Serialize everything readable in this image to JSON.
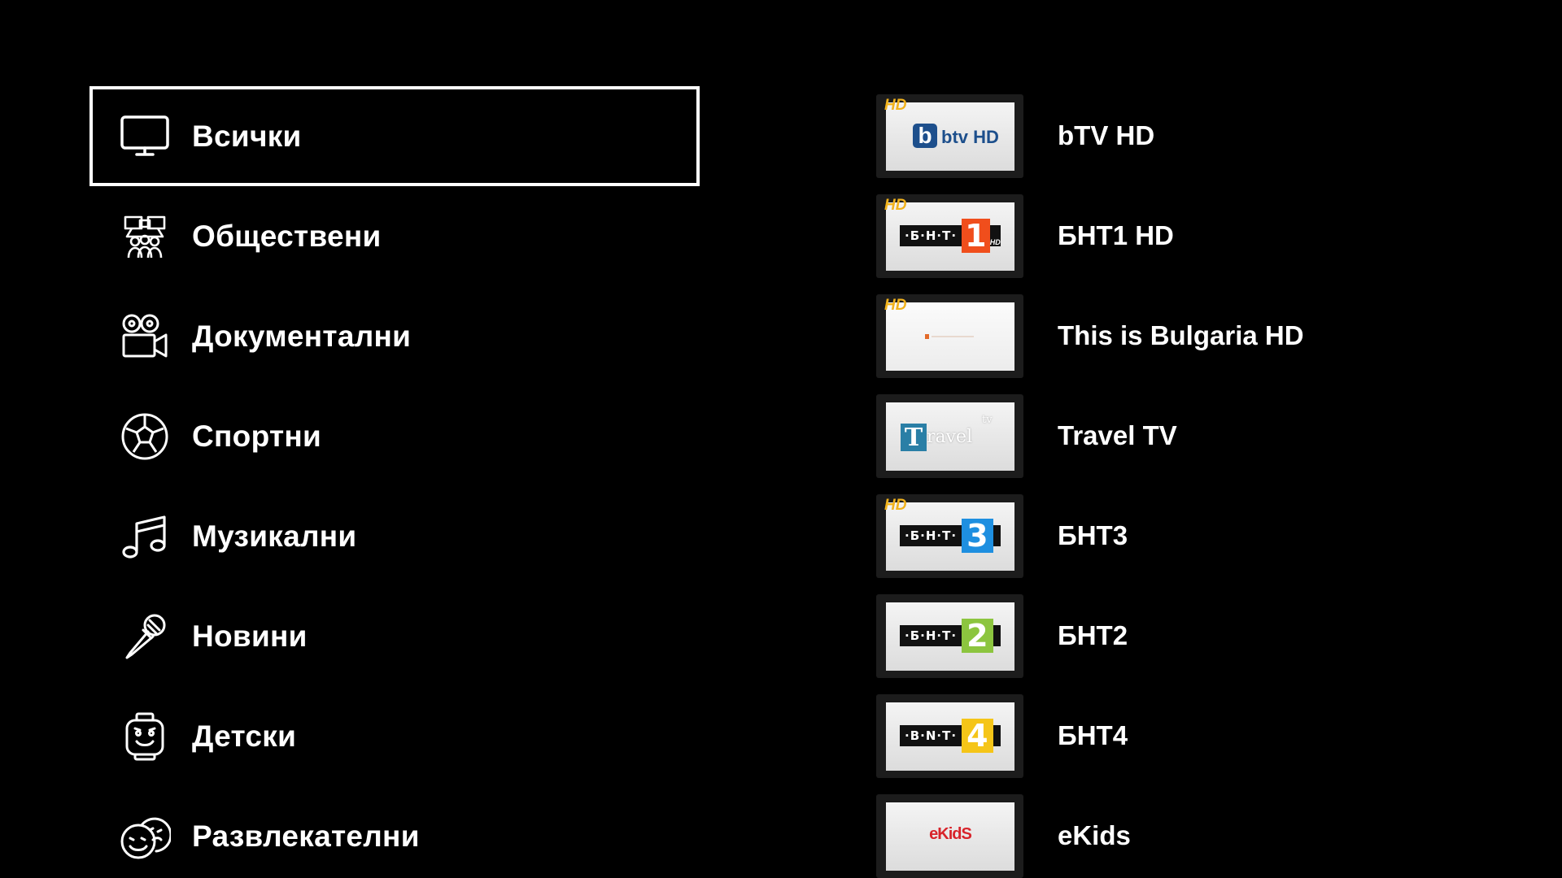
{
  "categories": [
    {
      "label": "Всички",
      "icon": "tv-icon",
      "selected": true
    },
    {
      "label": "Обществени",
      "icon": "community-icon",
      "selected": false
    },
    {
      "label": "Документални",
      "icon": "film-camera-icon",
      "selected": false
    },
    {
      "label": "Спортни",
      "icon": "soccer-ball-icon",
      "selected": false
    },
    {
      "label": "Музикални",
      "icon": "music-note-icon",
      "selected": false
    },
    {
      "label": "Новини",
      "icon": "microphone-icon",
      "selected": false
    },
    {
      "label": "Детски",
      "icon": "toy-face-icon",
      "selected": false
    },
    {
      "label": "Развлекателни",
      "icon": "theater-masks-icon",
      "selected": false
    }
  ],
  "channels": [
    {
      "name": "bTV HD",
      "hd": "HD",
      "logo_text": "btv HD",
      "logo_letter": "b"
    },
    {
      "name": "БНТ1 HD",
      "hd": "HD",
      "logo_text": "·Б·Н·Т·",
      "logo_number": "1",
      "logo_suffix": "HD",
      "accent": "#f04e1c"
    },
    {
      "name": "This is Bulgaria HD",
      "hd": "HD"
    },
    {
      "name": "Travel TV",
      "logo_letter": "T",
      "logo_text": "ravel",
      "logo_suffix": "tv"
    },
    {
      "name": "БНТ3",
      "hd": "HD",
      "logo_text": "·Б·Н·Т·",
      "logo_number": "3",
      "accent": "#1e8fe0"
    },
    {
      "name": "БНТ2",
      "logo_text": "·Б·Н·Т·",
      "logo_number": "2",
      "accent": "#8cc53f"
    },
    {
      "name": "БНТ4",
      "logo_text": "·B·N·T·",
      "logo_number": "4",
      "accent": "#f5c518"
    },
    {
      "name": "eKids",
      "logo_text": "eKidS"
    }
  ],
  "colors": {
    "background": "#000000",
    "text": "#ffffff",
    "selection_border": "#ffffff",
    "hd_badge": "#f1b21c",
    "btv_blue": "#1d4f8c",
    "travel_blue": "#2a7fa6"
  }
}
